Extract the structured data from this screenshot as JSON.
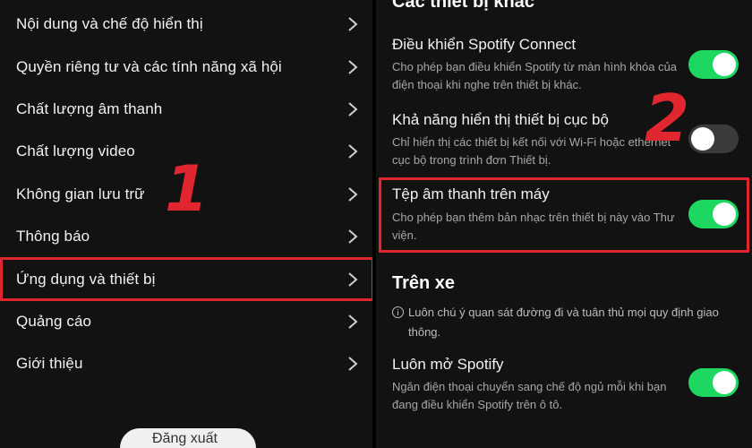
{
  "left_menu": {
    "items": [
      {
        "label": "Nội dung và chế độ hiển thị"
      },
      {
        "label": "Quyền riêng tư và các tính năng xã hội"
      },
      {
        "label": "Chất lượng âm thanh"
      },
      {
        "label": "Chất lượng video"
      },
      {
        "label": "Không gian lưu trữ"
      },
      {
        "label": "Thông báo"
      },
      {
        "label": "Ứng dụng và thiết bị"
      },
      {
        "label": "Quảng cáo"
      },
      {
        "label": "Giới thiệu"
      }
    ],
    "highlighted_item": "Ứng dụng và thiết bị",
    "bottom_button_label": "Đăng xuất"
  },
  "annotations": {
    "marker_1": "1",
    "marker_2": "2",
    "highlight_color": "#e0262e"
  },
  "right_panel": {
    "section_other_devices": "Các thiết bị khác",
    "settings": [
      {
        "title": "Điều khiển Spotify Connect",
        "description": "Cho phép bạn điều khiển Spotify từ màn hình khóa của điện thoại khi nghe trên thiết bị khác.",
        "enabled": true
      },
      {
        "title": "Khả năng hiển thị thiết bị cục bộ",
        "description": "Chỉ hiển thị các thiết bị kết nối với Wi-Fi hoặc ethernet cục bộ trong trình đơn Thiết bị.",
        "enabled": false
      },
      {
        "title": "Tệp âm thanh trên máy",
        "description": "Cho phép bạn thêm bản nhạc trên thiết bị này vào Thư viện.",
        "enabled": true
      }
    ],
    "section_car": "Trên xe",
    "car_info": "Luôn chú ý quan sát đường đi và tuân thủ mọi quy định giao thông.",
    "car_setting": {
      "title": "Luôn mở Spotify",
      "description": "Ngăn điện thoại chuyển sang chế độ ngủ mỗi khi bạn đang điều khiển Spotify trên ô tô.",
      "enabled": true
    }
  },
  "colors": {
    "toggle_on": "#1ed760",
    "toggle_off": "#3b3b3b",
    "background": "#121212"
  }
}
